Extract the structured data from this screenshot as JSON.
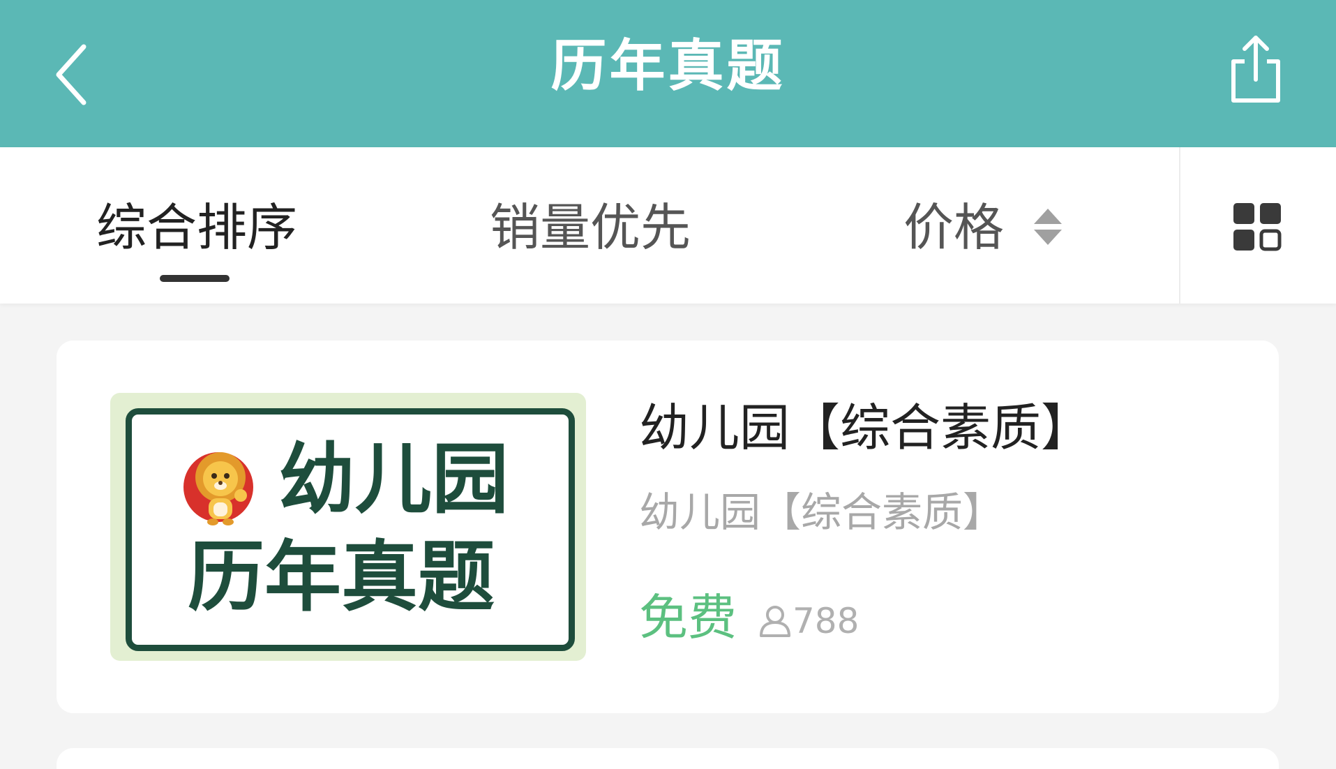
{
  "header": {
    "title": "历年真题",
    "back_icon": "chevron-left-icon",
    "share_icon": "share-icon",
    "bg_color": "#5bb8b5"
  },
  "sort_bar": {
    "tabs": [
      {
        "label": "综合排序",
        "active": true
      },
      {
        "label": "销量优先",
        "active": false
      },
      {
        "label": "价格",
        "active": false
      }
    ],
    "price_sort_icon": "sort-updown-icon",
    "layout_toggle_icon": "grid-view-icon"
  },
  "items": [
    {
      "cover": {
        "line1": "幼儿园",
        "line2": "历年真题",
        "mascot_icon": "lion-mascot-icon"
      },
      "title": "幼儿园【综合素质】",
      "subtitle": "幼儿园【综合素质】",
      "price": "免费",
      "price_color": "#5cc080",
      "learner_icon": "user-icon",
      "learner_count": "788"
    }
  ]
}
